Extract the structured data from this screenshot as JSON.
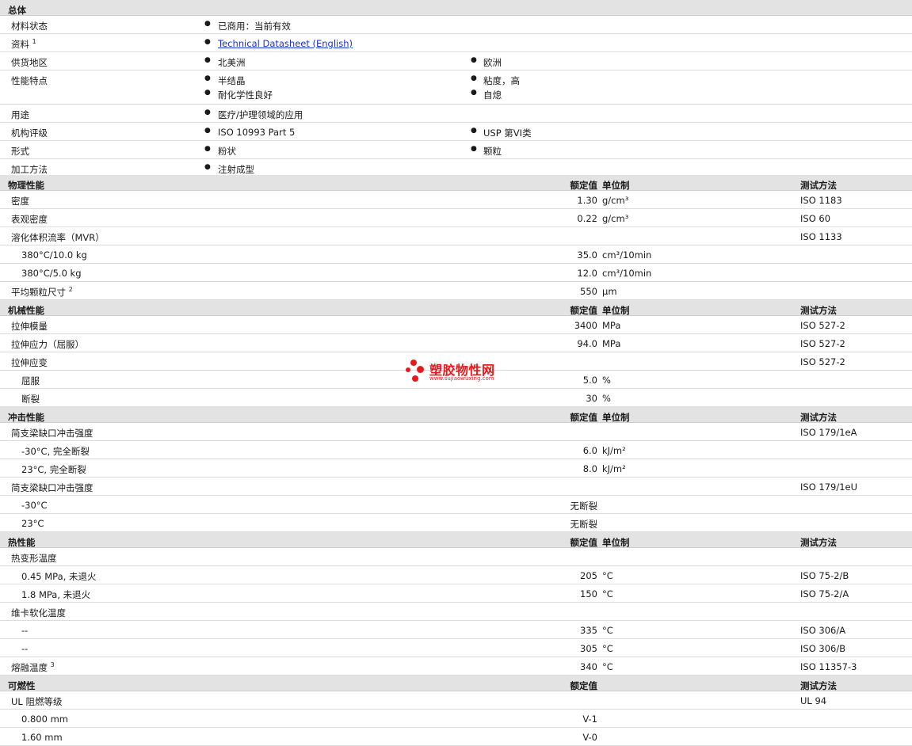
{
  "general": {
    "section_title": "总体",
    "material_status": {
      "label": "材料状态",
      "value": "已商用：当前有效"
    },
    "literature": {
      "label": "资料",
      "sup": "1",
      "link": "Technical Datasheet (English)"
    },
    "availability": {
      "label": "供货地区",
      "v1": "北美洲",
      "v2": "欧洲"
    },
    "features": {
      "label": "性能特点",
      "v1": "半结晶",
      "v2": "粘度，高",
      "v3": "耐化学性良好",
      "v4": "自熄"
    },
    "uses": {
      "label": "用途",
      "v1": "医疗/护理领域的应用"
    },
    "agency": {
      "label": "机构评级",
      "v1": "ISO 10993 Part 5",
      "v2": "USP 第VI类"
    },
    "forms": {
      "label": "形式",
      "v1": "粉状",
      "v2": "颗粒"
    },
    "processing": {
      "label": "加工方法",
      "v1": "注射成型"
    }
  },
  "headers": {
    "nominal": "额定值",
    "unit": "单位制",
    "method": "测试方法"
  },
  "physical": {
    "title": "物理性能",
    "rows": [
      {
        "label": "密度",
        "value": "1.30",
        "unit": "g/cm³",
        "method": "ISO 1183"
      },
      {
        "label": "表观密度",
        "value": "0.22",
        "unit": "g/cm³",
        "method": "ISO 60"
      },
      {
        "label": "溶化体积流率（MVR）",
        "value": "",
        "unit": "",
        "method": "ISO 1133"
      },
      {
        "label": "380°C/10.0 kg",
        "value": "35.0",
        "unit": "cm³/10min",
        "method": ""
      },
      {
        "label": "380°C/5.0 kg",
        "value": "12.0",
        "unit": "cm³/10min",
        "method": ""
      },
      {
        "label": "平均颗粒尺寸",
        "sup": "2",
        "value": "550",
        "unit": "µm",
        "method": ""
      }
    ]
  },
  "mechanical": {
    "title": "机械性能",
    "rows": [
      {
        "label": "拉伸模量",
        "value": "3400",
        "unit": "MPa",
        "method": "ISO 527-2"
      },
      {
        "label": "拉伸应力（屈服）",
        "value": "94.0",
        "unit": "MPa",
        "method": "ISO 527-2"
      },
      {
        "label": "拉伸应变",
        "value": "",
        "unit": "",
        "method": "ISO 527-2"
      },
      {
        "label": "屈服",
        "value": "5.0",
        "unit": "%",
        "method": ""
      },
      {
        "label": "断裂",
        "value": "30",
        "unit": "%",
        "method": ""
      }
    ]
  },
  "impact": {
    "title": "冲击性能",
    "rows": [
      {
        "label": "简支梁缺口冲击强度",
        "value": "",
        "unit": "",
        "method": "ISO 179/1eA"
      },
      {
        "label": "-30°C, 完全断裂",
        "value": "6.0",
        "unit": "kJ/m²",
        "method": ""
      },
      {
        "label": "23°C, 完全断裂",
        "value": "8.0",
        "unit": "kJ/m²",
        "method": ""
      },
      {
        "label": "简支梁缺口冲击强度",
        "value": "",
        "unit": "",
        "method": "ISO 179/1eU"
      },
      {
        "label": "-30°C",
        "value": "无断裂",
        "unit": "",
        "method": ""
      },
      {
        "label": "23°C",
        "value": "无断裂",
        "unit": "",
        "method": ""
      }
    ]
  },
  "thermal": {
    "title": "热性能",
    "rows": [
      {
        "label": "热变形温度",
        "value": "",
        "unit": "",
        "method": ""
      },
      {
        "label": "0.45 MPa, 未退火",
        "value": "205",
        "unit": "°C",
        "method": "ISO 75-2/B"
      },
      {
        "label": "1.8 MPa, 未退火",
        "value": "150",
        "unit": "°C",
        "method": "ISO 75-2/A"
      },
      {
        "label": "维卡软化温度",
        "value": "",
        "unit": "",
        "method": ""
      },
      {
        "label": "--",
        "value": "335",
        "unit": "°C",
        "method": "ISO 306/A"
      },
      {
        "label": "--",
        "value": "305",
        "unit": "°C",
        "method": "ISO 306/B"
      },
      {
        "label": "熔融温度",
        "sup": "3",
        "value": "340",
        "unit": "°C",
        "method": "ISO 11357-3"
      }
    ]
  },
  "flammability": {
    "title": "可燃性",
    "rows": [
      {
        "label": "UL 阻燃等级",
        "value": "",
        "method": "UL 94"
      },
      {
        "label": "0.800 mm",
        "value": "V-1",
        "method": ""
      },
      {
        "label": "1.60 mm",
        "value": "V-0",
        "method": ""
      }
    ]
  },
  "watermark": {
    "text": "塑胶物性网",
    "url": "www.sujiaowuxing.com",
    "color": "#e8191a"
  }
}
